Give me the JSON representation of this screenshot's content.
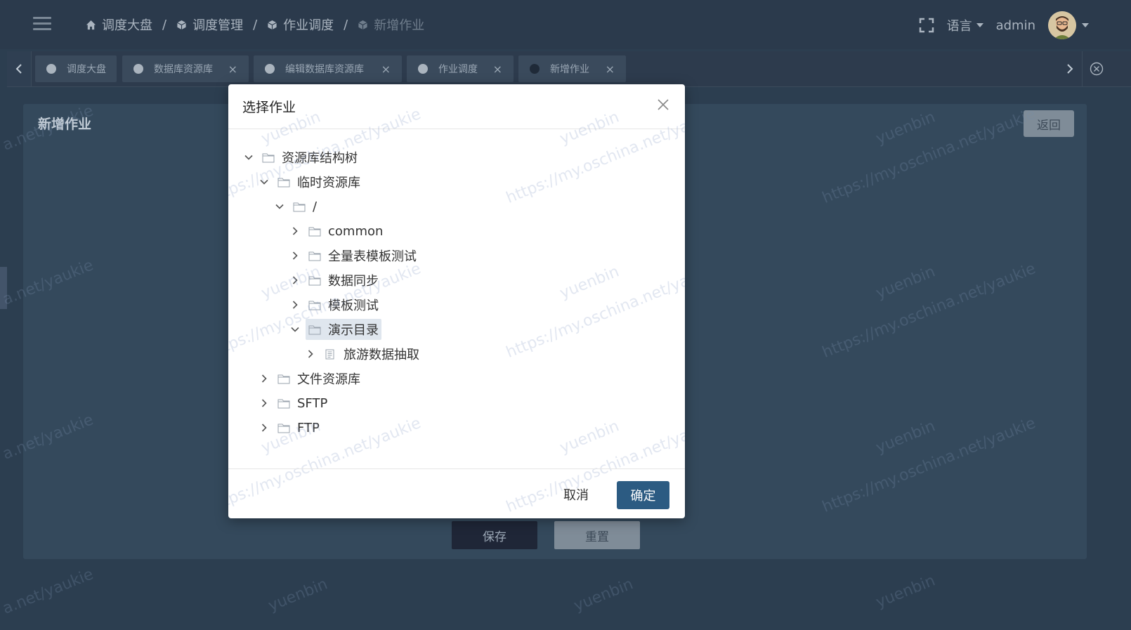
{
  "header": {
    "breadcrumb": [
      "调度大盘",
      "调度管理",
      "作业调度",
      "新增作业"
    ],
    "breadcrumb_separator": "/",
    "language_label": "语言",
    "username": "admin"
  },
  "tabs": [
    {
      "label": "调度大盘",
      "closable": false
    },
    {
      "label": "数据库资源库",
      "closable": true
    },
    {
      "label": "编辑数据库资源库",
      "closable": true
    },
    {
      "label": "作业调度",
      "closable": true
    },
    {
      "label": "新增作业",
      "closable": true,
      "active": true
    }
  ],
  "tab_close_symbol": "×",
  "page": {
    "title": "新增作业",
    "back_label": "返回",
    "save_label": "保存",
    "reset_label": "重置"
  },
  "modal": {
    "title": "选择作业",
    "cancel_label": "取消",
    "confirm_label": "确定",
    "tree": [
      {
        "label": "资源库结构树",
        "expanded": true,
        "icon": "folder-icon"
      },
      {
        "label": "临时资源库",
        "expanded": true,
        "icon": "folder-icon"
      },
      {
        "label": "/",
        "expanded": true,
        "icon": "folder-icon"
      },
      {
        "label": "common",
        "expanded": false,
        "icon": "folder-icon"
      },
      {
        "label": "全量表模板测试",
        "expanded": false,
        "icon": "folder-icon"
      },
      {
        "label": "数据同步",
        "expanded": false,
        "icon": "folder-icon"
      },
      {
        "label": "模板测试",
        "expanded": false,
        "icon": "folder-icon"
      },
      {
        "label": "演示目录",
        "expanded": true,
        "icon": "folder-icon",
        "selected": true
      },
      {
        "label": "旅游数据抽取",
        "expanded": false,
        "icon": "file-icon"
      },
      {
        "label": "文件资源库",
        "expanded": false,
        "icon": "folder-icon"
      },
      {
        "label": "SFTP",
        "expanded": false,
        "icon": "folder-icon"
      },
      {
        "label": "FTP",
        "expanded": false,
        "icon": "folder-icon"
      }
    ]
  },
  "watermark": {
    "name": "yuenbin",
    "url": "https://my.oschina.net/yaukie",
    "short": "a.net/yaukie"
  },
  "colors": {
    "primary": "#2c5b82",
    "header_bg": "#2b3a4c",
    "card_bg": "#34495c"
  }
}
